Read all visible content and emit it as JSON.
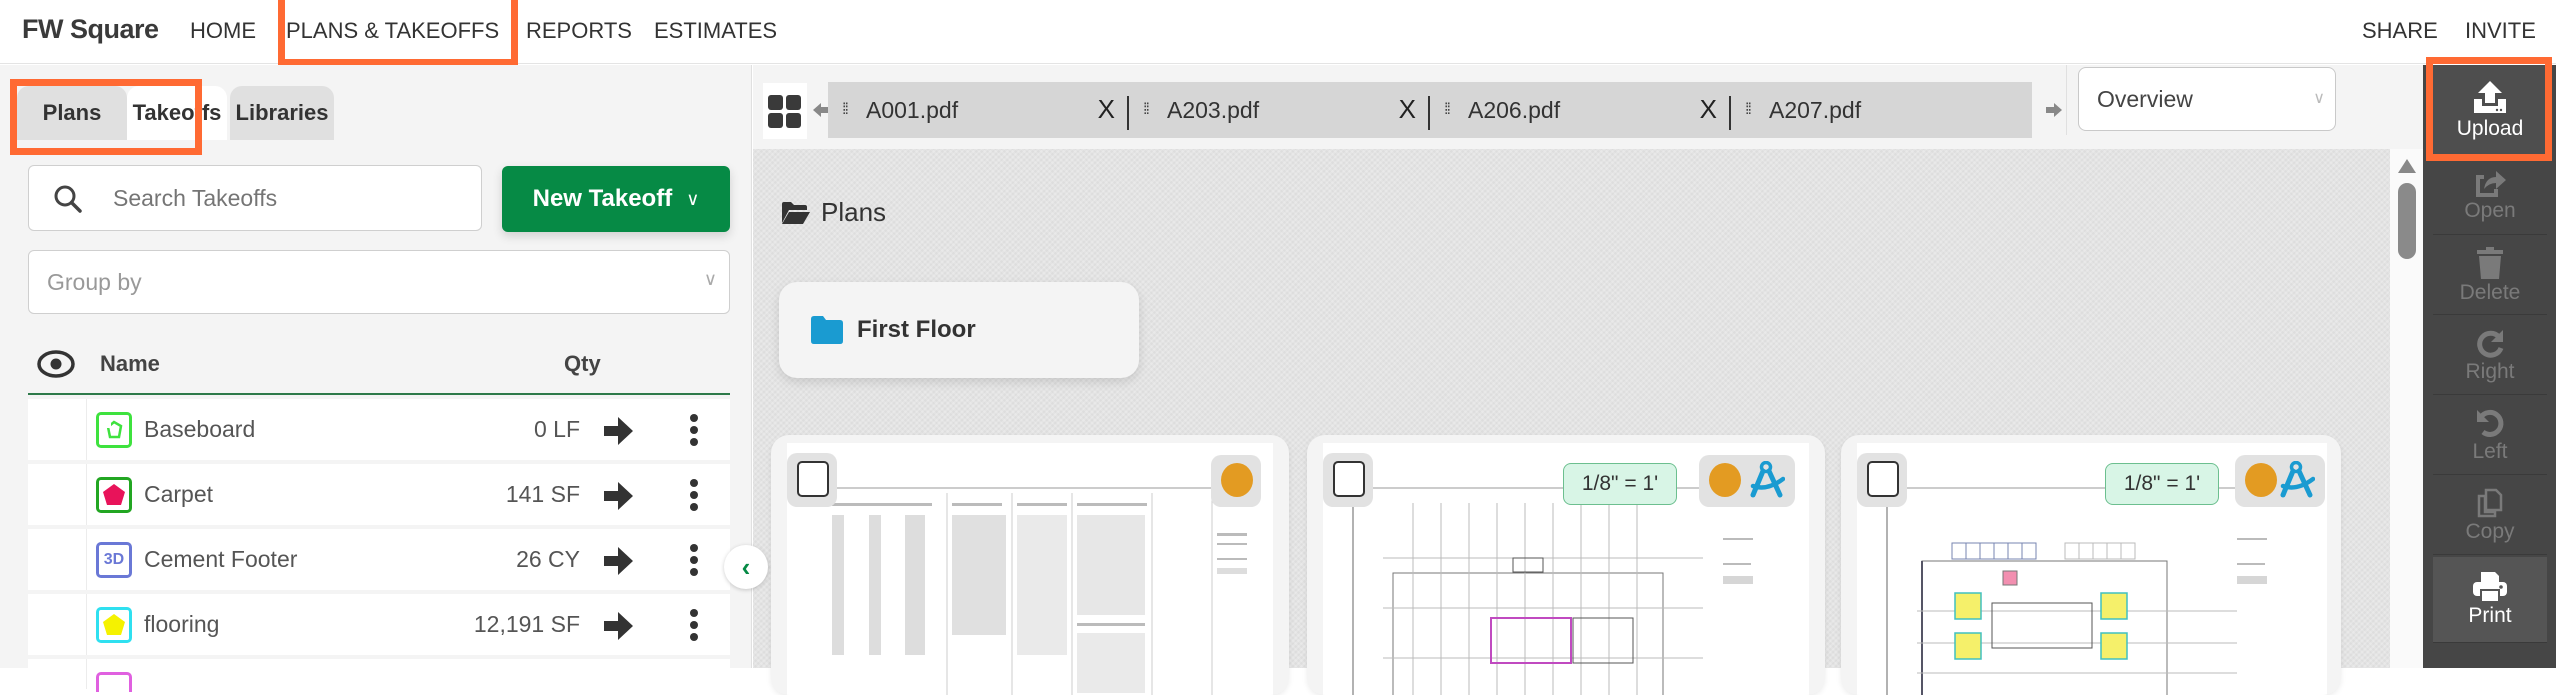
{
  "topnav": {
    "brand": "FW Square",
    "links": [
      "HOME",
      "PLANS & TAKEOFFS",
      "REPORTS",
      "ESTIMATES"
    ],
    "active_link": "PLANS & TAKEOFFS",
    "right_links": [
      "SHARE",
      "INVITE"
    ]
  },
  "left_panel": {
    "tabs": [
      {
        "label": "Plans",
        "active": false
      },
      {
        "label": "Takeoffs",
        "active": true
      },
      {
        "label": "Libraries",
        "active": false
      }
    ],
    "search": {
      "placeholder": "Search Takeoffs",
      "value": ""
    },
    "new_takeoff_label": "New Takeoff",
    "group_by": {
      "placeholder": "Group by",
      "value": ""
    },
    "table": {
      "headers": {
        "name": "Name",
        "qty": "Qty"
      },
      "rows": [
        {
          "name": "Baseboard",
          "qty": "0 LF",
          "icon": "linear-pentagon-outline-icon",
          "icon_border": "#3ee23e",
          "icon_fill": "#3ee23e"
        },
        {
          "name": "Carpet",
          "qty": "141 SF",
          "icon": "area-pentagon-icon",
          "icon_border": "#22a622",
          "icon_fill": "#e8135a"
        },
        {
          "name": "Cement Footer",
          "qty": "26 CY",
          "icon": "volume-3d-icon",
          "icon_border": "#6a78d6",
          "icon_fill": "#6a78d6",
          "icon_text": "3D"
        },
        {
          "name": "flooring",
          "qty": "12,191 SF",
          "icon": "area-pentagon-icon",
          "icon_border": "#2fe0f0",
          "icon_fill": "#f5f200"
        }
      ]
    }
  },
  "main": {
    "doc_tabs": [
      {
        "name": "A001.pdf",
        "close": "X"
      },
      {
        "name": "A203.pdf",
        "close": "X"
      },
      {
        "name": "A206.pdf",
        "close": "X"
      },
      {
        "name": "A207.pdf",
        "close": ""
      }
    ],
    "view_select": {
      "value": "Overview"
    },
    "section_title": "Plans",
    "folders": [
      {
        "name": "First Floor"
      }
    ],
    "sheets": [
      {
        "scale": "",
        "status_color": "#e39b22",
        "calibrated": false
      },
      {
        "scale": "1/8\" = 1'",
        "status_color": "#e39b22",
        "calibrated": true
      },
      {
        "scale": "1/8\" = 1'",
        "status_color": "#e39b22",
        "calibrated": true
      }
    ]
  },
  "toolbar": {
    "buttons": [
      {
        "label": "Upload",
        "enabled": true
      },
      {
        "label": "Open",
        "enabled": false
      },
      {
        "label": "Delete",
        "enabled": false
      },
      {
        "label": "Right",
        "enabled": false
      },
      {
        "label": "Left",
        "enabled": false
      },
      {
        "label": "Copy",
        "enabled": false
      },
      {
        "label": "Print",
        "enabled": true
      }
    ]
  },
  "colors": {
    "accent_green": "#068a45",
    "highlight_orange": "#ff6a33",
    "folder_blue": "#1a9bd1",
    "toolbar_dark": "#464646"
  }
}
